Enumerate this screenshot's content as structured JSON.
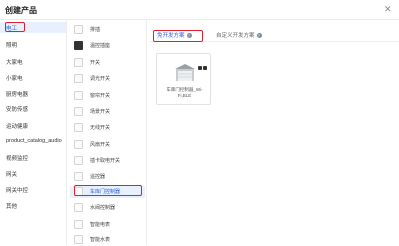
{
  "dialog": {
    "title": "创建产品",
    "close_icon": "close-icon"
  },
  "categories": {
    "selected": "电工",
    "items": [
      "照明",
      "大家电",
      "小家电",
      "厨房电器",
      "安防传感",
      "运动健康",
      "product_catalog_audio",
      "视频监控",
      "网关",
      "网关中控",
      "其他"
    ]
  },
  "subcategories": {
    "items": [
      "排插",
      "温控插座",
      "开关",
      "调光开关",
      "窗帘开关",
      "场景开关",
      "无线开关",
      "风扇开关",
      "插卡取电开关",
      "遥控器",
      "车库门控制器",
      "水阀控制器",
      "智能电表",
      "智能水表"
    ],
    "active": "车库门控制器"
  },
  "tabs": {
    "active": "免开发方案",
    "inactive": "自定义开发方案"
  },
  "product_card": {
    "name": "车库门控制器_Wi-Fi,BLE",
    "icon": "garage-door-icon"
  },
  "colors": {
    "accent": "#2b5fe0",
    "highlight": "#e0202c",
    "selected_bg": "#e8effd"
  }
}
